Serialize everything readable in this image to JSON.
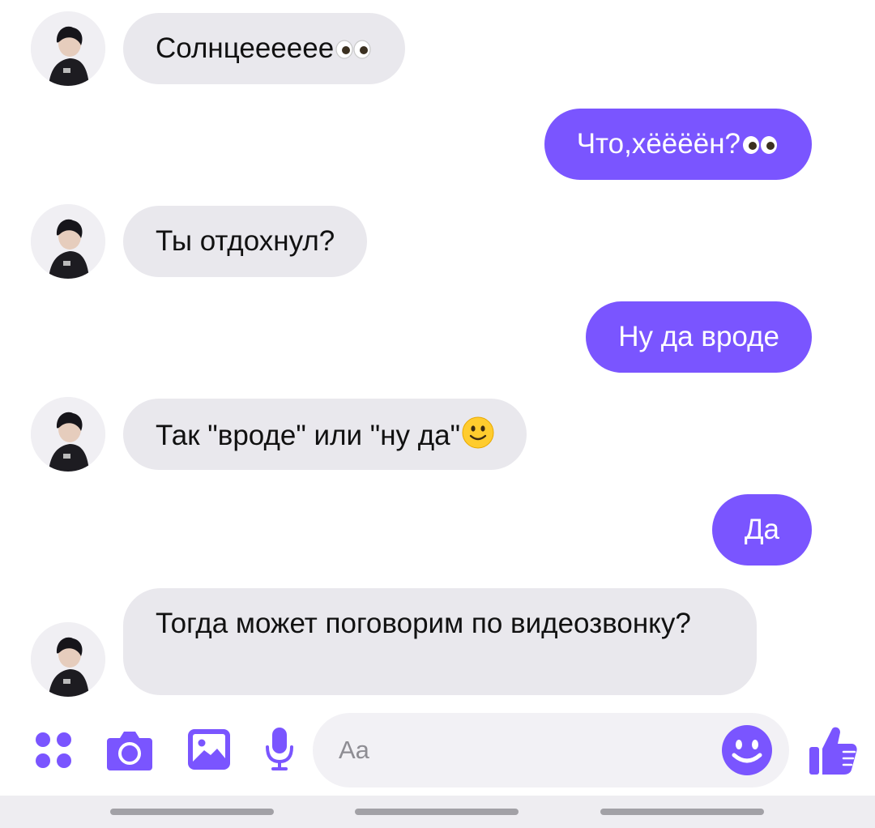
{
  "messages": [
    {
      "text": "Солнцееееее",
      "emoji": "eyes"
    },
    {
      "text": "Что,хёёёён?",
      "emoji": "eyes"
    },
    {
      "text": "Ты отдохнул?"
    },
    {
      "text": "Ну да вроде"
    },
    {
      "text": "Так \"вроде\" или \"ну да\"",
      "emoji": "smile"
    },
    {
      "text": "Да"
    },
    {
      "text": "Тогда может поговорим по видеозвонку?"
    }
  ],
  "composer": {
    "placeholder": "Aa",
    "icons": [
      "apps-icon",
      "camera-icon",
      "gallery-icon",
      "microphone-icon",
      "emoji-icon",
      "thumbs-up-icon"
    ]
  },
  "colors": {
    "accent": "#7a55ff",
    "incoming_bubble": "#e9e8ed",
    "outgoing_bubble": "#7a55ff"
  }
}
